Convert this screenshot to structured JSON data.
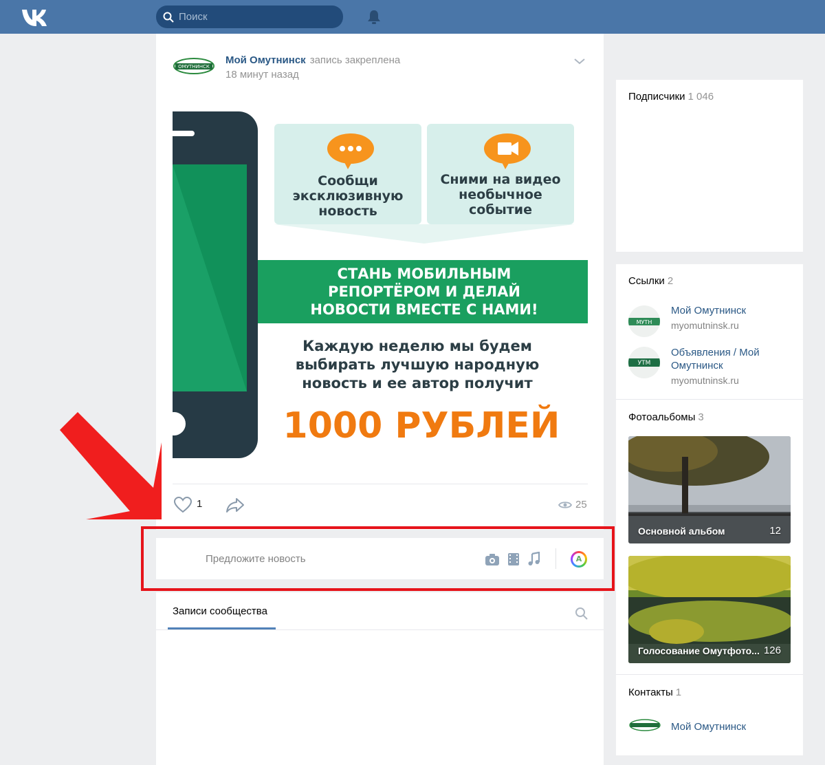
{
  "header": {
    "search_placeholder": "Поиск"
  },
  "post": {
    "author": "Мой Омутнинск",
    "pinned_label": "запись закреплена",
    "time": "18 минут назад",
    "banner": {
      "card1": [
        "Сообщи",
        "эксклюзивную",
        "новость"
      ],
      "card2": [
        "Сними на видео",
        "необычное",
        "событие"
      ],
      "headline": [
        "СТАНЬ МОБИЛЬНЫМ",
        "РЕПОРТЁРОМ И ДЕЛАЙ",
        "НОВОСТИ ВМЕСТЕ С НАМИ!"
      ],
      "body": [
        "Каждую неделю мы будем",
        "выбирать лучшую народную",
        "новость и ее автор получит"
      ],
      "prize": "1000 РУБЛЕЙ"
    },
    "likes": "1",
    "views": "25"
  },
  "suggest": {
    "placeholder": "Предложите новость",
    "avatar_letter": "A"
  },
  "wall": {
    "tab_label": "Записи сообщества"
  },
  "sidebar": {
    "subscribers": {
      "title": "Подписчики",
      "count": "1 046"
    },
    "links": {
      "title": "Ссылки",
      "count": "2",
      "items": [
        {
          "title": "Мой Омутнинск",
          "url": "myomutninsk.ru"
        },
        {
          "title": "Объявления / Мой Омутнинск",
          "url": "myomutninsk.ru"
        }
      ]
    },
    "albums": {
      "title": "Фотоальбомы",
      "count": "3",
      "items": [
        {
          "title": "Основной альбом",
          "count": "12"
        },
        {
          "title": "Голосование Омутфото...",
          "count": "126"
        }
      ]
    },
    "contacts": {
      "title": "Контакты",
      "count": "1",
      "name": "Мой Омутнинск"
    }
  },
  "colors": {
    "header": "#4a76a8",
    "link": "#2a5885",
    "highlight": "#e6141b",
    "banner_green": "#1a9f5f",
    "prize_orange": "#f07a10"
  }
}
